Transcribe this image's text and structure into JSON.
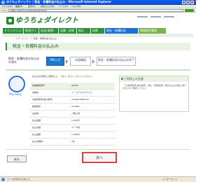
{
  "window": {
    "title": "ゆうちょダイレクト | 税金・各種料金の払込み - Microsoft Internet Explorer",
    "menu": [
      "ファイル(F)",
      "編集(E)",
      "表示(V)",
      "お気に入り(A)",
      "ツール(T)",
      "ヘルプ(H)"
    ],
    "address_label": "アドレス",
    "address": "https://direct.jp-bank.japanpost.jp/"
  },
  "brand": {
    "name": "ゆうちょダイレクト"
  },
  "tabs": [
    "メインメニュー",
    "照会(Ｐ)",
    "送金(振替)",
    "定額・定期",
    "振込",
    "振替",
    "税金・各種料金",
    "情報提供業務"
  ],
  "breadcrumb": "メインメニュー ＞ 税金・各種料金の払込み",
  "page": {
    "title": "税金・各種料金の払込み"
  },
  "steps": {
    "intro": "税金・各種料金の払込みの流れ",
    "items": [
      "PIN入力",
      "内容確認",
      "税金・各種料金の払込み完了"
    ]
  },
  "payeasy": {
    "label": "Pay-easy"
  },
  "form": {
    "intro": "払込みの内容をご確認の上、「次へ」をクリックしてください。",
    "rows": [
      {
        "label": "収納機関番号",
        "value": "58100"
      },
      {
        "label": "収納先",
        "value": "イーコアマナビテスト"
      },
      {
        "label": "お客様番号(納付番号)",
        "value": "1234567890123"
      },
      {
        "label": "確認番号",
        "value": "123456"
      },
      {
        "label": "お名前",
        "value": "ご購入者"
      },
      {
        "label": "払込金額",
        "value": "1,000円"
      },
      {
        "label": "払込内容",
        "value": "ユーザ様"
      },
      {
        "label": "払込金額",
        "value": "1,000円"
      },
      {
        "label": "払込手数料",
        "value": "0円"
      }
    ]
  },
  "notice": {
    "title": "ご利用上の注意",
    "body": "・「お客様番号(納付番号)」欄に「確認番号」欄の払込み内容に誤りがないかご確認ください。"
  },
  "buttons": {
    "back": "戻る",
    "next": "次へ"
  },
  "status": {
    "text": "ページが表示されました",
    "zone": "インターネット"
  },
  "colors": {
    "brand_green": "#2f8f3c",
    "active_tab": "#1d6fd0",
    "next_highlight": "#e04040"
  }
}
